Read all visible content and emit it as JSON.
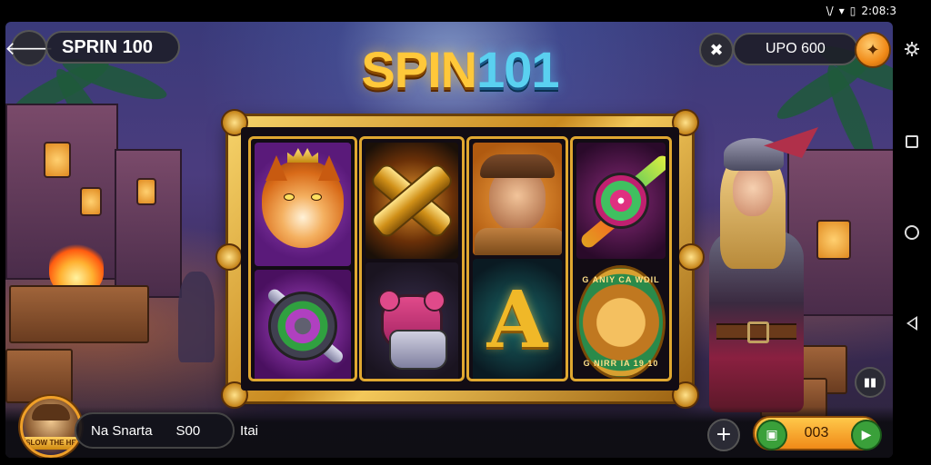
{
  "status_bar": {
    "time": "2:08:3",
    "network_label": "\\/"
  },
  "header": {
    "back_icon": "arrow-left-icon",
    "title": "SPRIN 100",
    "logo_letters": "SPIN",
    "logo_digits": "101",
    "balance": "UPO 600"
  },
  "reels": {
    "symbols": [
      [
        "crowned-tiger",
        "gem-rocket"
      ],
      [
        "golden-bones-x",
        "robot-bear"
      ],
      [
        "adventurer-man",
        "golden-letter-a"
      ],
      [
        "spiked-orb",
        "cougar-medallion"
      ]
    ],
    "medallion_top": "G ANIY CA WDIL",
    "medallion_bottom": "G NIRR IA 19 10"
  },
  "footer": {
    "avatar_label": "SLOW THE HE",
    "player_name": "Na Snarta",
    "player_amount": "S00",
    "bet_label": "Itai",
    "spin_value": "003"
  },
  "nav": {
    "items": [
      "settings-icon",
      "recents-icon",
      "home-icon",
      "back-icon"
    ]
  },
  "colors": {
    "accent_gold": "#f0b828",
    "logo_blue": "#5ad0f0",
    "spin_orange": "#f08a18",
    "cash_green": "#3aa03a"
  }
}
